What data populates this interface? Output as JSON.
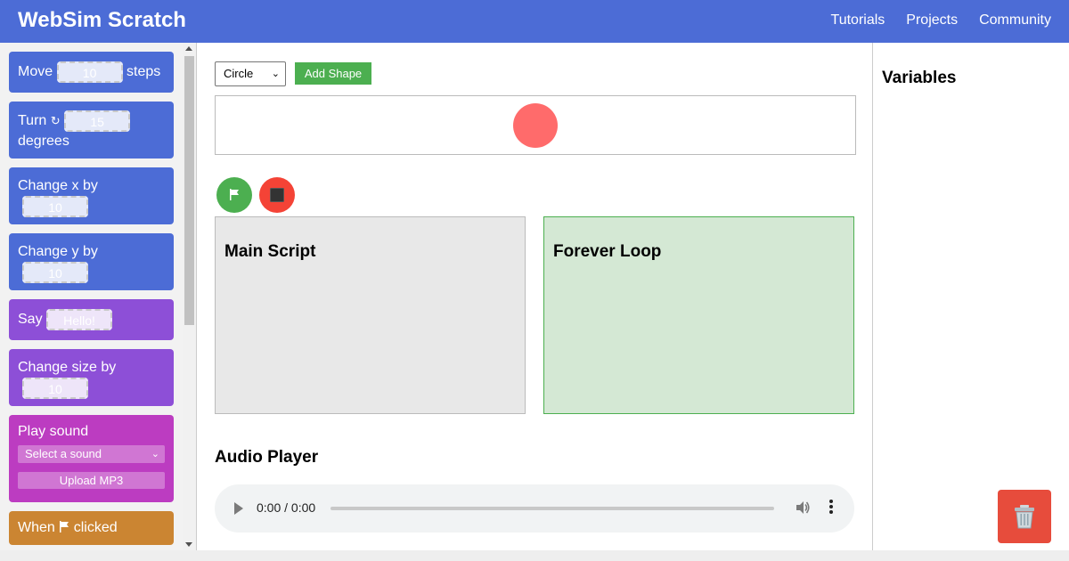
{
  "header": {
    "title": "WebSim Scratch",
    "nav": [
      "Tutorials",
      "Projects",
      "Community"
    ]
  },
  "palette": {
    "move": {
      "pre": "Move",
      "value": "10",
      "post": "steps"
    },
    "turn": {
      "pre": "Turn",
      "arrow": "↻",
      "value": "15",
      "post": "degrees"
    },
    "change_x": {
      "label": "Change x by",
      "value": "10"
    },
    "change_y": {
      "label": "Change y by",
      "value": "10"
    },
    "say": {
      "label": "Say",
      "value": "Hello!"
    },
    "change_size": {
      "label": "Change size by",
      "value": "10"
    },
    "play_sound": {
      "label": "Play sound",
      "select_placeholder": "Select a sound",
      "upload_label": "Upload MP3"
    },
    "when_clicked": {
      "pre": "When",
      "post": "clicked"
    }
  },
  "toolbar": {
    "shape_value": "Circle",
    "add_shape_label": "Add Shape"
  },
  "scripts": {
    "main_title": "Main Script",
    "loop_title": "Forever Loop"
  },
  "audio": {
    "title": "Audio Player",
    "time": "0:00 / 0:00"
  },
  "variables": {
    "title": "Variables"
  },
  "colors": {
    "header": "#4c6cd6",
    "motion": "#4c6cd6",
    "looks": "#8d4fd7",
    "sound": "#bc3cc1",
    "events": "#cb8532",
    "sprite": "#ff6b6b",
    "run": "#4caf50",
    "stop": "#f44336",
    "trash": "#e74c3c"
  },
  "icons": {
    "run": "green-flag-icon",
    "stop": "stop-icon",
    "trash": "trash-icon",
    "flag": "flag-icon"
  }
}
